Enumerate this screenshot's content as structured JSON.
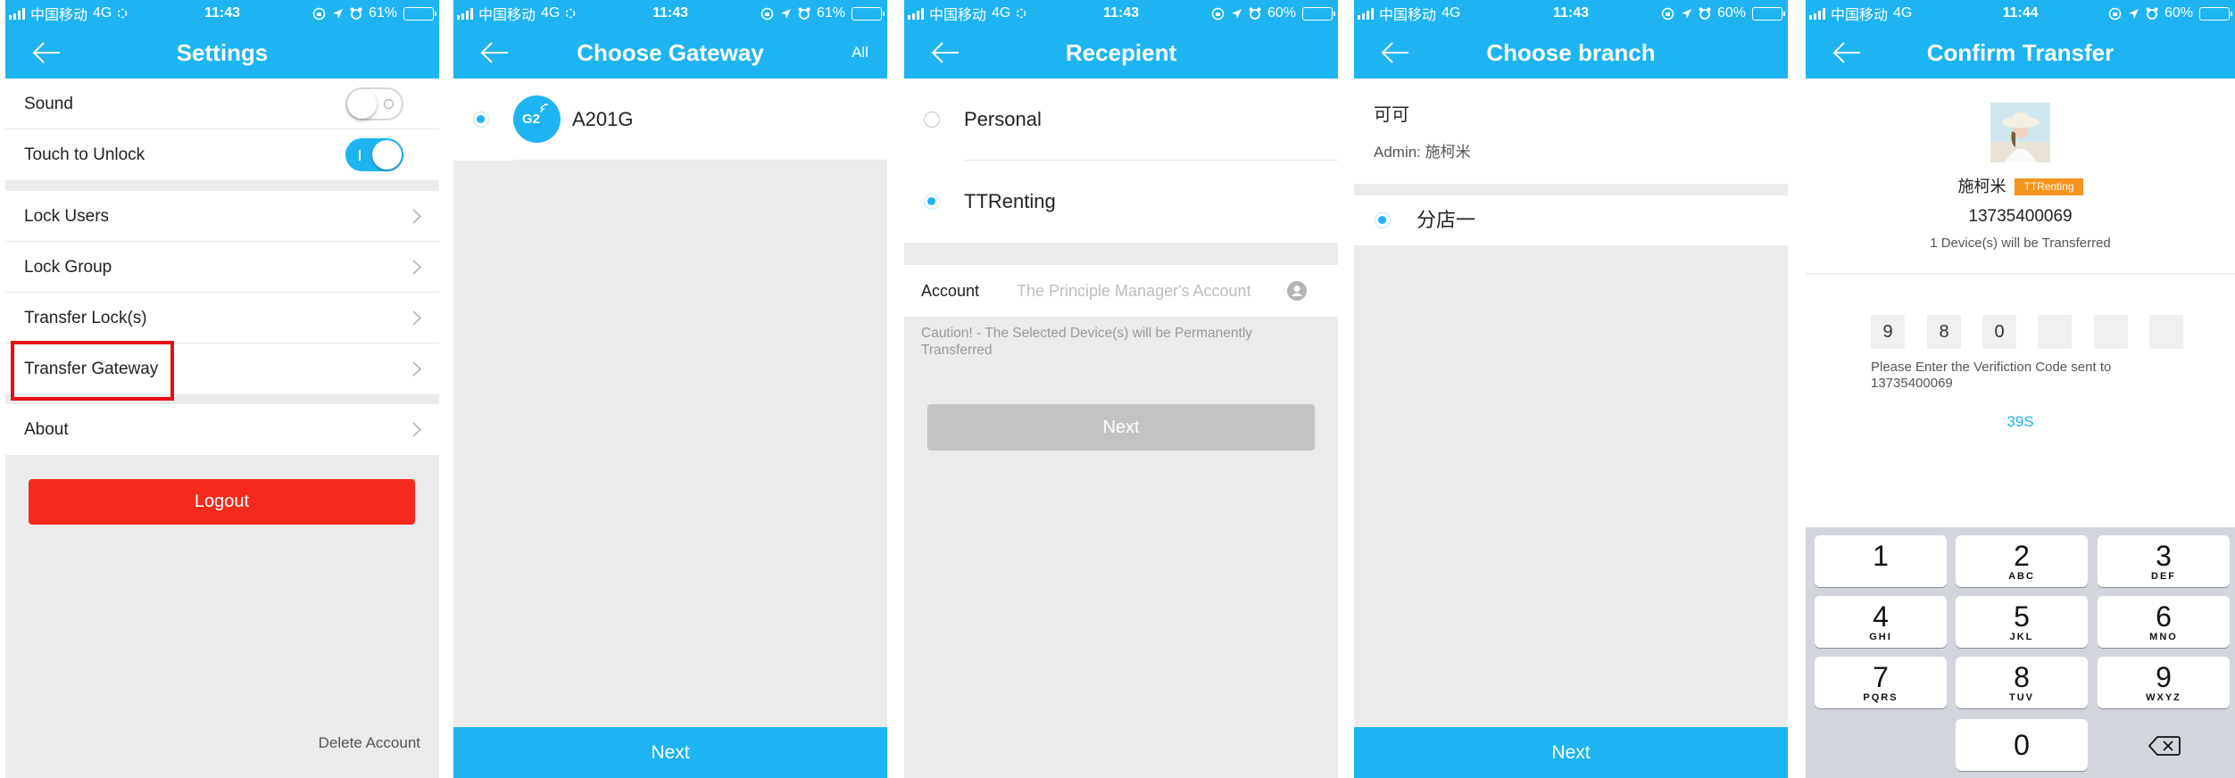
{
  "colors": {
    "accent": "#1db4f1",
    "danger": "#f42a1d",
    "badge": "#f7941d",
    "background": "#ebebeb",
    "disabled": "#c3c3c3"
  },
  "icons": {
    "back": "arrow-left-icon",
    "chevron": "chevron-right-icon",
    "gateway": "gateway-icon",
    "contact": "contact-icon",
    "delete": "backspace-icon",
    "avatar": "user-avatar",
    "status": [
      "signal-icon",
      "activity-icon",
      "rotation-lock-icon",
      "location-icon",
      "alarm-icon",
      "battery-icon"
    ]
  },
  "status_bars": [
    {
      "carrier": "中国移动",
      "network": "4G",
      "time": "11:43",
      "battery": "61%",
      "battery_level": 0.61,
      "activity": true
    },
    {
      "carrier": "中国移动",
      "network": "4G",
      "time": "11:43",
      "battery": "61%",
      "battery_level": 0.61,
      "activity": true
    },
    {
      "carrier": "中国移动",
      "network": "4G",
      "time": "11:43",
      "battery": "60%",
      "battery_level": 0.6,
      "activity": true
    },
    {
      "carrier": "中国移动",
      "network": "4G",
      "time": "11:43",
      "battery": "60%",
      "battery_level": 0.6,
      "activity": false
    },
    {
      "carrier": "中国移动",
      "network": "4G",
      "time": "11:44",
      "battery": "60%",
      "battery_level": 0.6,
      "activity": false
    }
  ],
  "settings": {
    "title": "Settings",
    "toggles": [
      {
        "label": "Sound",
        "on": false
      },
      {
        "label": "Touch to Unlock",
        "on": true
      }
    ],
    "menu": [
      "Lock Users",
      "Lock Group",
      "Transfer Lock(s)",
      "Transfer Gateway"
    ],
    "highlighted_item": "Transfer Gateway",
    "about": "About",
    "logout": "Logout",
    "delete_account": "Delete Account"
  },
  "choose_gateway": {
    "title": "Choose Gateway",
    "action": "All",
    "gateways": [
      {
        "name": "A201G",
        "icon_label": "G2",
        "selected": true
      }
    ],
    "next": "Next"
  },
  "recipient": {
    "title": "Recepient",
    "options": [
      {
        "label": "Personal",
        "selected": false
      },
      {
        "label": "TTRenting",
        "selected": true
      }
    ],
    "account_label": "Account",
    "account_placeholder": "The Principle Manager's Account",
    "account_value": "",
    "caution": "Caution! - The Selected Device(s) will be Permanently Transferred",
    "next": "Next"
  },
  "choose_branch": {
    "title": "Choose branch",
    "company": "可可",
    "admin": "Admin: 施柯米",
    "branches": [
      {
        "name": "分店一",
        "selected": true
      }
    ],
    "next": "Next"
  },
  "confirm_transfer": {
    "title": "Confirm Transfer",
    "user_name": "施柯米",
    "company_badge": "TTRenting",
    "phone": "13735400069",
    "device_note": "1 Device(s) will be Transferred",
    "code_digits": [
      "9",
      "8",
      "0",
      "",
      "",
      ""
    ],
    "instruction": "Please Enter the Verifiction Code sent to 13735400069",
    "countdown": "39S",
    "keypad": [
      {
        "digit": "1",
        "letters": ""
      },
      {
        "digit": "2",
        "letters": "ABC"
      },
      {
        "digit": "3",
        "letters": "DEF"
      },
      {
        "digit": "4",
        "letters": "GHI"
      },
      {
        "digit": "5",
        "letters": "JKL"
      },
      {
        "digit": "6",
        "letters": "MNO"
      },
      {
        "digit": "7",
        "letters": "PQRS"
      },
      {
        "digit": "8",
        "letters": "TUV"
      },
      {
        "digit": "9",
        "letters": "WXYZ"
      },
      {
        "digit": "0",
        "letters": ""
      }
    ]
  }
}
